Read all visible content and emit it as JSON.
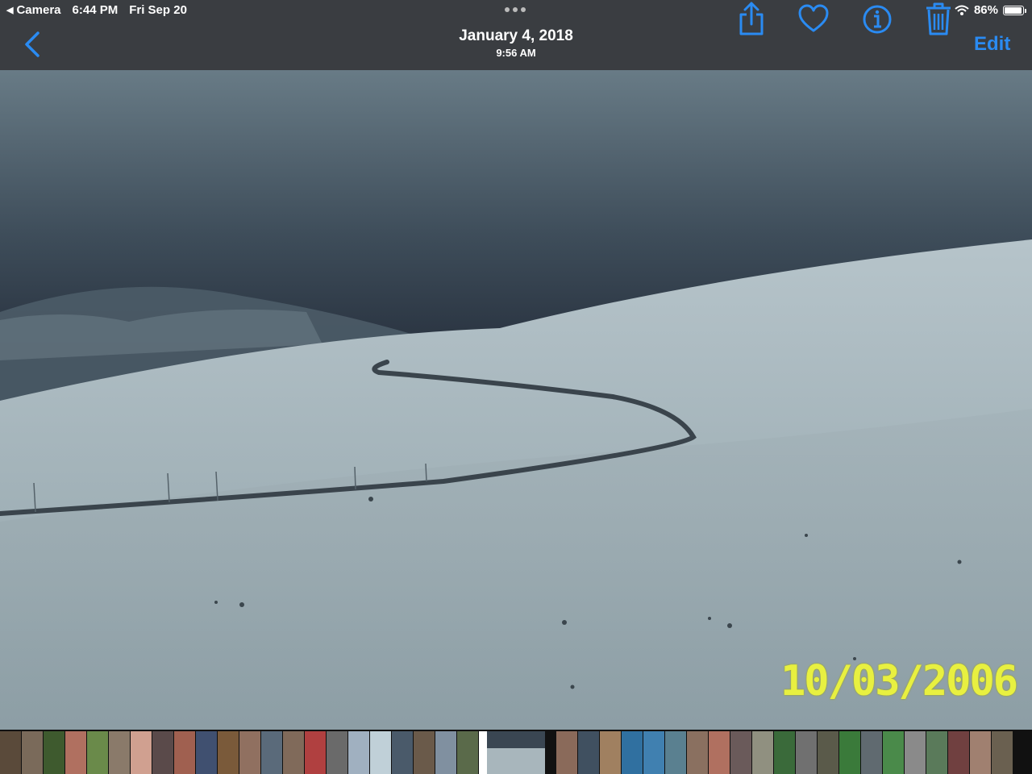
{
  "status_bar": {
    "back_app": "Camera",
    "time": "6:44 PM",
    "date": "Fri Sep 20",
    "battery": "86%",
    "battery_level": 0.86
  },
  "header": {
    "date": "January 4, 2018",
    "time": "9:56 AM",
    "edit_label": "Edit"
  },
  "photo": {
    "date_stamp": "10/03/2006"
  },
  "colors": {
    "accent": "#2a8bf2",
    "toolbar": "#3a3d41",
    "stamp": "#e8f040"
  },
  "icons": [
    "back-chevron-icon",
    "share-icon",
    "heart-icon",
    "info-icon",
    "trash-icon",
    "wifi-icon",
    "battery-icon"
  ]
}
